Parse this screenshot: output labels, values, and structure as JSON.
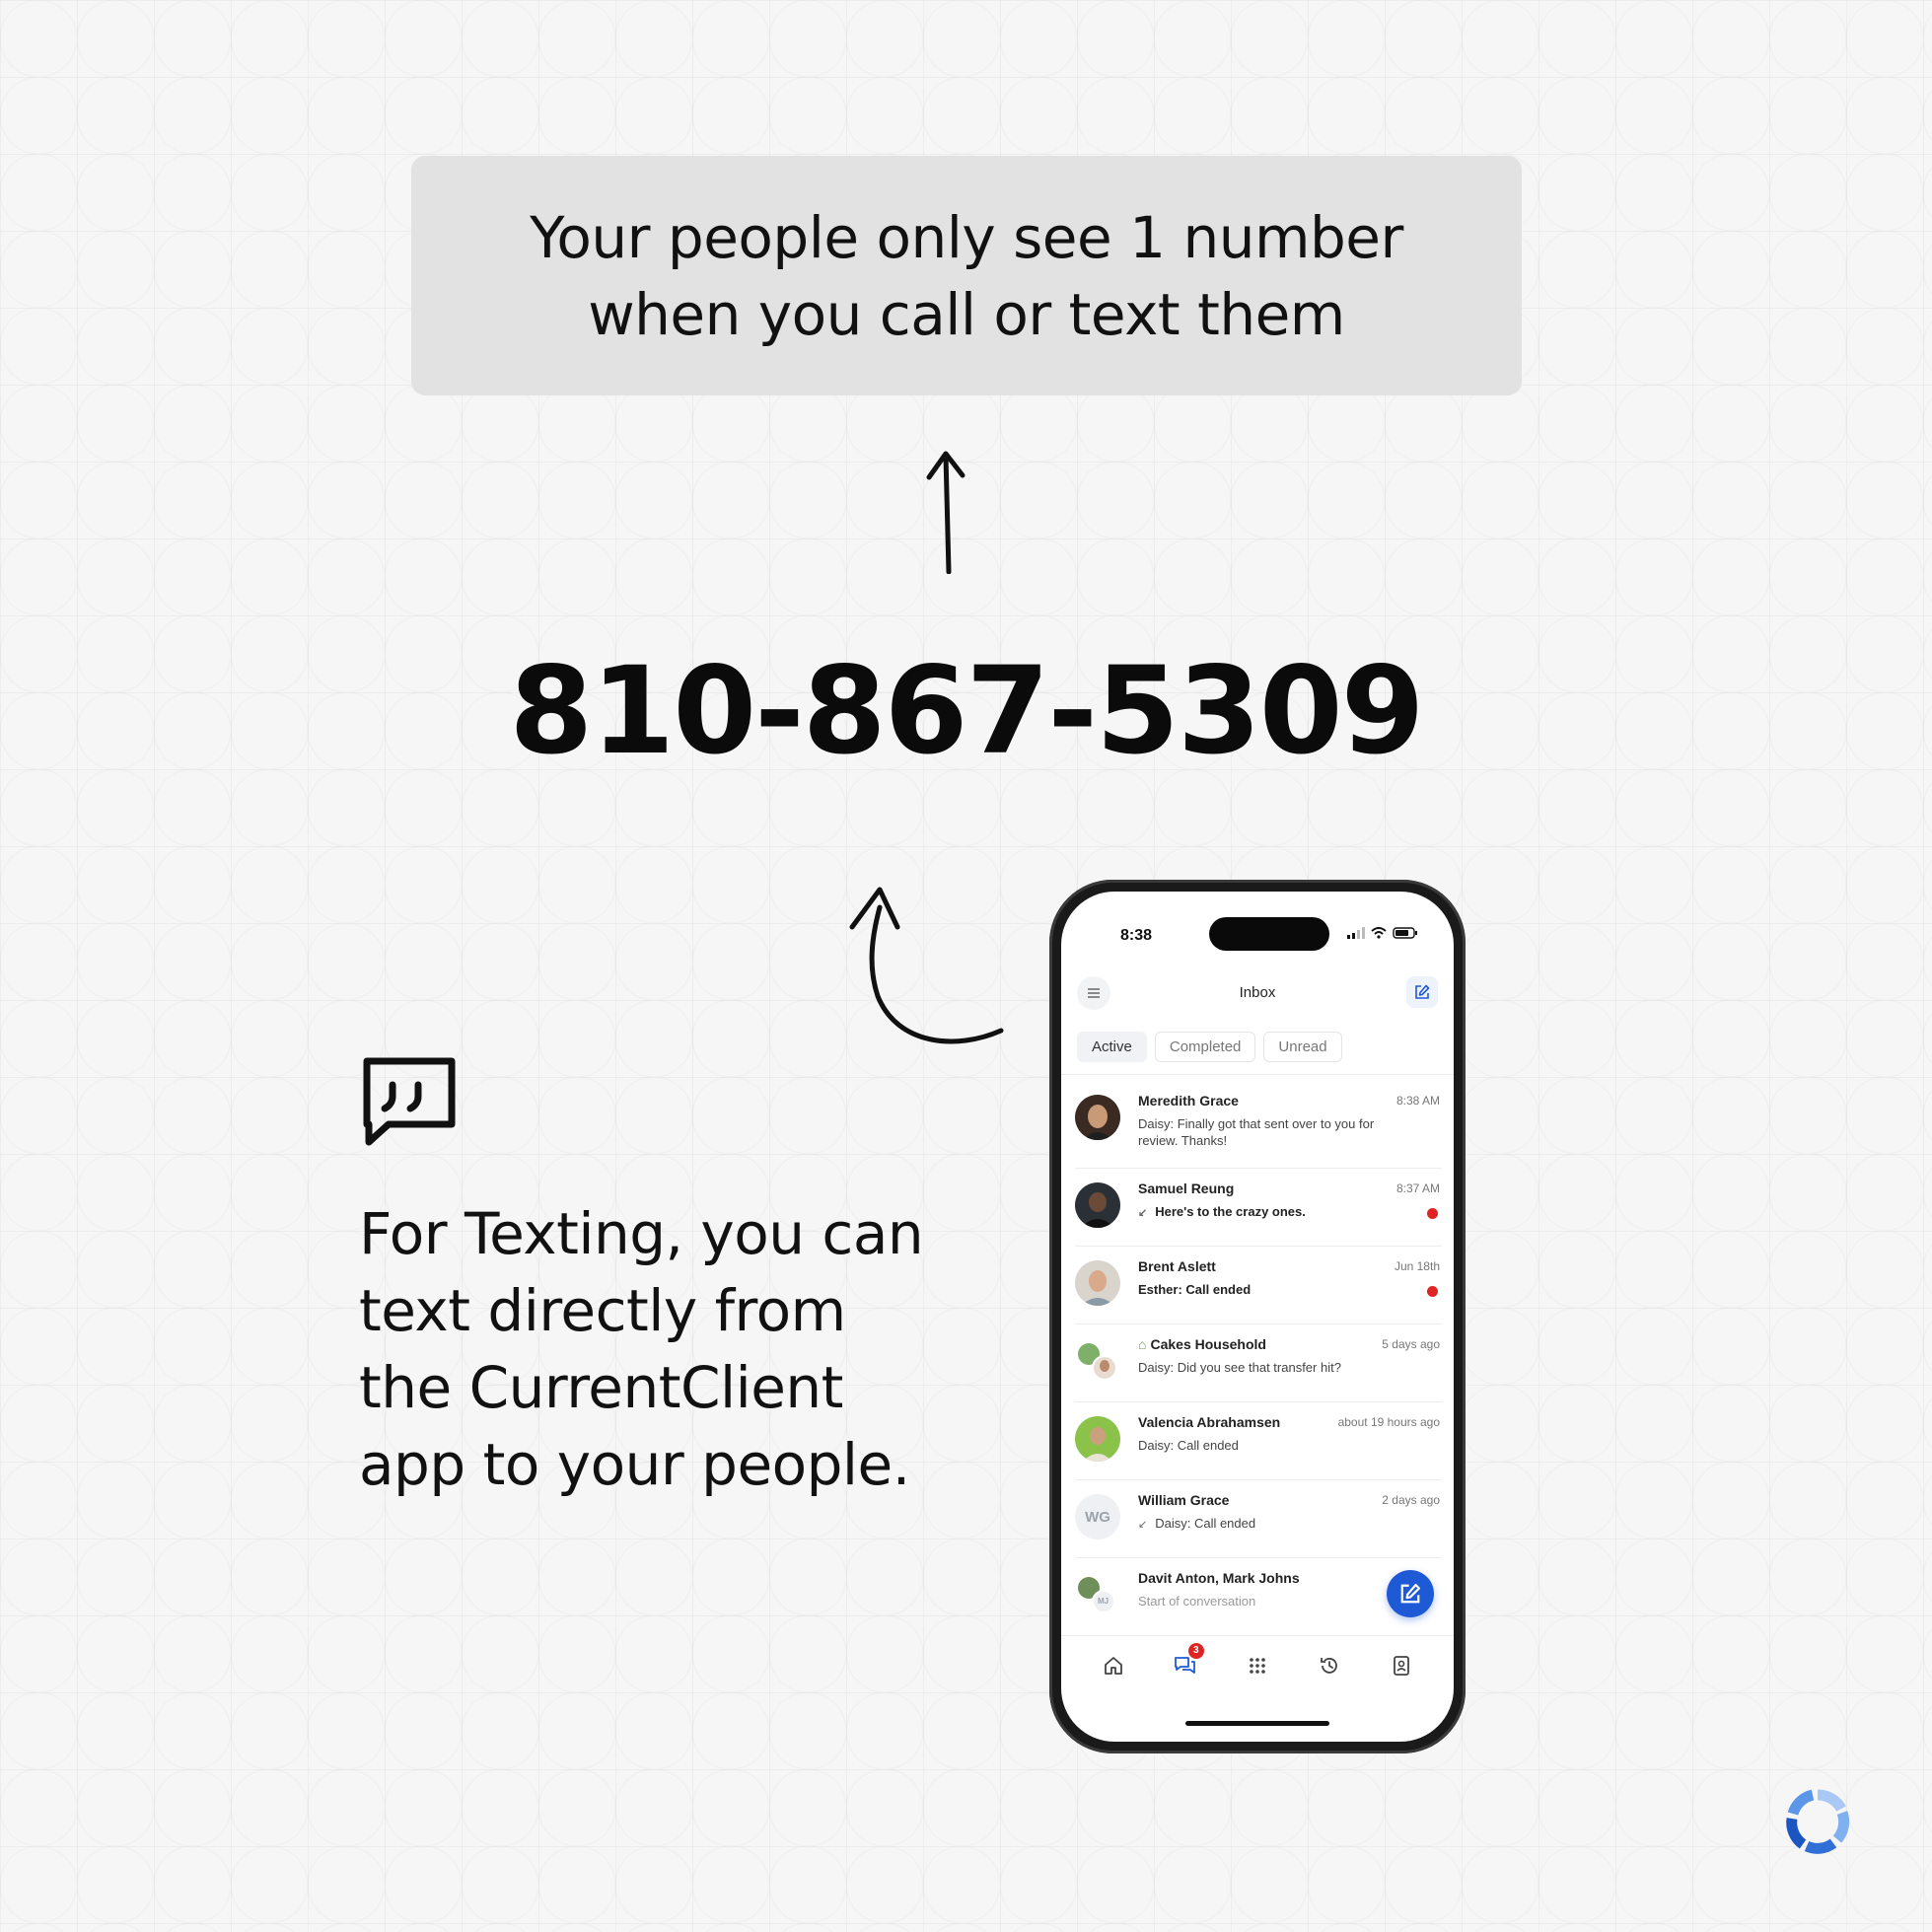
{
  "headline": {
    "line1": "Your people only see 1 number",
    "line2": "when you call or text them"
  },
  "phone_number": "810-867-5309",
  "body_text": {
    "line1": "For Texting, you can",
    "line2": "text directly from",
    "line3": "the CurrentClient",
    "line4": "app to your people."
  },
  "icons": {
    "quote": "message-quote-icon",
    "logo": "brand-ring-logo",
    "arrow_up": "arrow-up-icon",
    "curved_arrow": "curved-arrow-icon"
  },
  "phone": {
    "status_time": "8:38",
    "inbox_title": "Inbox",
    "tabs": [
      {
        "label": "Active",
        "active": true
      },
      {
        "label": "Completed",
        "active": false
      },
      {
        "label": "Unread",
        "active": false
      }
    ],
    "conversations": [
      {
        "name": "Meredith Grace",
        "time": "8:38 AM",
        "preview": "Daisy: Finally got that sent over to you for review. Thanks!",
        "unread": false
      },
      {
        "name": "Samuel Reung",
        "time": "8:37 AM",
        "preview": "Here's to the crazy ones.",
        "unread": true
      },
      {
        "name": "Brent Aslett",
        "time": "Jun 18th",
        "preview": "Esther: Call ended",
        "unread": true
      },
      {
        "name": "Cakes Household",
        "time": "5 days ago",
        "preview": "Daisy: Did you see that transfer hit?",
        "unread": false
      },
      {
        "name": "Valencia Abrahamsen",
        "time": "about 19 hours ago",
        "preview": "Daisy: Call ended",
        "unread": false
      },
      {
        "name": "William Grace",
        "time": "2 days ago",
        "preview": "Daisy: Call ended",
        "initials": "WG",
        "unread": false
      },
      {
        "name": "Davit Anton, Mark Johns",
        "time": "",
        "preview": "Start of conversation",
        "initials": "MJ",
        "unread": false
      }
    ],
    "nav_badge": "3",
    "accent_color": "#1e5ad6",
    "unread_color": "#e02424"
  }
}
